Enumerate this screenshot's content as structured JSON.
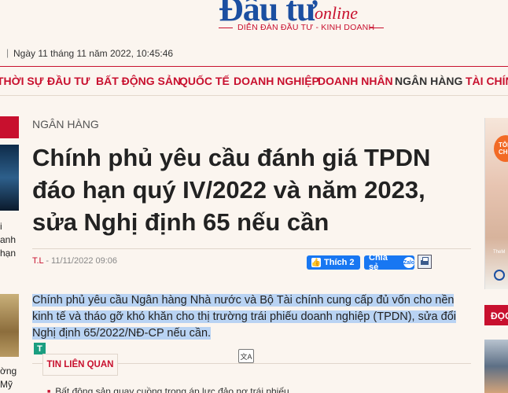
{
  "header": {
    "logo_main": "Đầu tư",
    "logo_online": "online",
    "tagline": "DIỄN ĐÀN ĐẦU TƯ - KINH DOANH",
    "date": "Ngày 11 tháng 11 năm 2022, 10:45:46"
  },
  "nav": {
    "items": [
      "THỜI SỰ",
      "ĐẦU TƯ",
      "BẤT ĐỘNG SẢN",
      "QUỐC TẾ",
      "DOANH NGHIỆP",
      "DOANH NHÂN",
      "NGÂN HÀNG",
      "TÀI CHÍNH"
    ],
    "active": "NGÂN HÀNG"
  },
  "left_sidebar": {
    "text_lines": [
      "i",
      "anh",
      "hạn",
      "ờng",
      "Mỹ"
    ]
  },
  "right_ad": {
    "badge": "TÔI CHỌ",
    "small_text": "TheM",
    "section_label": "ĐỌC"
  },
  "article": {
    "category": "NGÂN HÀNG",
    "title": "Chính phủ yêu cầu đánh giá TPDN đáo hạn quý IV/2022 và năm 2023, sửa Nghị định 65 nếu cần",
    "author": "T.L",
    "published": " - 11/11/2022 09:06",
    "like_label": "Thích 2",
    "share_label": "Chia sẻ",
    "zalo_label": "Zalo",
    "sapo": "Chính phủ yêu cầu Ngân hàng Nhà nước và Bộ Tài chính cung cấp đủ vốn cho nền kinh tế và tháo gỡ khó khăn cho thị trường trái phiếu doanh nghiệp (TPDN), sửa đổi Nghị định 65/2022/NĐ-CP nếu cần."
  },
  "related": {
    "tab_label": "TIN LIÊN QUAN",
    "items": [
      "Bất động sản quay cuồng trong áp lực đảo nợ trái phiếu"
    ]
  },
  "overlay": {
    "t_icon": "T",
    "translate_icon": "文A"
  },
  "colors": {
    "brand_red": "#c8102e",
    "brand_blue": "#1c4fa1",
    "facebook_blue": "#1877f2",
    "highlight": "#b9d3f3"
  }
}
